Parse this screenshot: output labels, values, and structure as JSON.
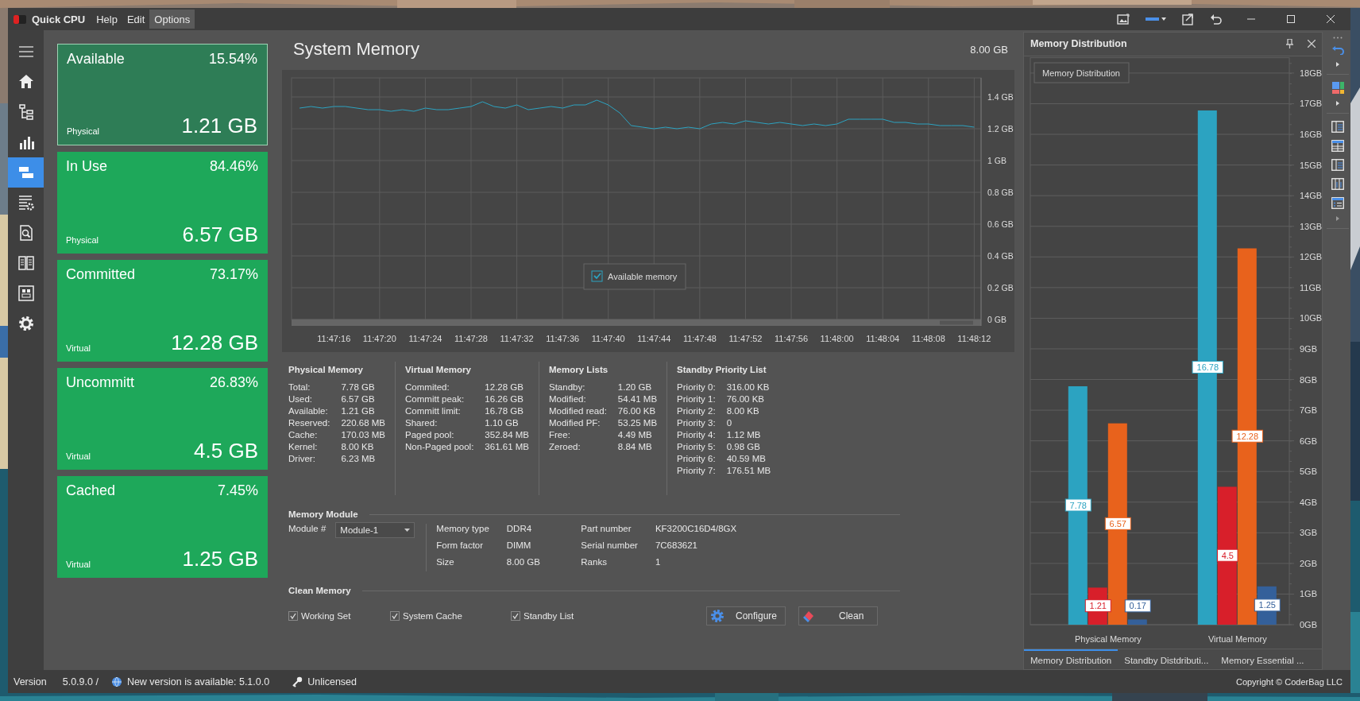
{
  "window": {
    "app_name": "Quick CPU",
    "menu": [
      {
        "label": "Help",
        "selected": false
      },
      {
        "label": "Edit",
        "selected": false
      },
      {
        "label": "Options",
        "selected": true
      }
    ]
  },
  "nav": [
    {
      "kind": "menu",
      "selected": false
    },
    {
      "kind": "home",
      "selected": false
    },
    {
      "kind": "tree",
      "selected": false
    },
    {
      "kind": "bar-chart",
      "selected": false
    },
    {
      "kind": "memory",
      "selected": true
    },
    {
      "kind": "table-settings",
      "selected": false
    },
    {
      "kind": "doc-search",
      "selected": false
    },
    {
      "kind": "book",
      "selected": false
    },
    {
      "kind": "board",
      "selected": false
    },
    {
      "kind": "settings",
      "selected": false
    }
  ],
  "cards": [
    {
      "label": "Available",
      "percent": "15.54%",
      "type": "Physical",
      "value": "1.21 GB",
      "selected": true
    },
    {
      "label": "In Use",
      "percent": "84.46%",
      "type": "Physical",
      "value": "6.57 GB",
      "selected": false
    },
    {
      "label": "Committed",
      "percent": "73.17%",
      "type": "Virtual",
      "value": "12.28 GB",
      "selected": false
    },
    {
      "label": "Uncommitt",
      "percent": "26.83%",
      "type": "Virtual",
      "value": "4.5 GB",
      "selected": false
    },
    {
      "label": "Cached",
      "percent": "7.45%",
      "type": "Virtual",
      "value": "1.25 GB",
      "selected": false
    }
  ],
  "main": {
    "title": "System Memory",
    "total": "8.00 GB",
    "legend_checked": true,
    "chart_data": {
      "type": "line",
      "grid": true,
      "categories": [
        null,
        null,
        null,
        "11:47:16",
        null,
        null,
        null,
        "11:47:20",
        null,
        null,
        null,
        "11:47:24",
        null,
        null,
        null,
        "11:47:28",
        null,
        null,
        null,
        "11:47:32",
        null,
        null,
        null,
        "11:47:36",
        null,
        null,
        null,
        "11:47:40",
        null,
        null,
        null,
        "11:47:44",
        null,
        null,
        null,
        "11:47:48",
        null,
        null,
        null,
        "11:47:52",
        null,
        null,
        null,
        "11:47:56",
        null,
        null,
        null,
        "11:48:00",
        null,
        null,
        null,
        "11:48:04",
        null,
        null,
        null,
        "11:48:08",
        null,
        null,
        null,
        "11:48:12"
      ],
      "series": [
        {
          "name": "Available memory",
          "color": "#2ca3c1",
          "values": [
            1.33,
            1.34,
            1.33,
            1.34,
            1.34,
            1.33,
            1.32,
            1.32,
            1.31,
            1.32,
            1.31,
            1.33,
            1.32,
            1.32,
            1.33,
            1.34,
            1.37,
            1.34,
            1.33,
            1.35,
            1.32,
            1.33,
            1.34,
            1.33,
            1.35,
            1.35,
            1.38,
            1.35,
            1.3,
            1.22,
            1.21,
            1.2,
            1.21,
            1.2,
            1.21,
            1.2,
            1.23,
            1.24,
            1.23,
            1.25,
            1.24,
            1.23,
            1.24,
            1.23,
            1.22,
            1.23,
            1.22,
            1.23,
            1.26,
            1.26,
            1.26,
            1.26,
            1.24,
            1.24,
            1.23,
            1.23,
            1.22,
            1.22,
            1.22,
            1.21
          ]
        }
      ],
      "ylim": [
        0,
        1.52
      ],
      "yticks": [
        {
          "value": 0,
          "label": "0 GB"
        },
        {
          "value": 0.2,
          "label": "0.2 GB"
        },
        {
          "value": 0.4,
          "label": "0.4 GB"
        },
        {
          "value": 0.6,
          "label": "0.6 GB"
        },
        {
          "value": 0.8,
          "label": "0.8 GB"
        },
        {
          "value": 1,
          "label": "1 GB"
        },
        {
          "value": 1.2,
          "label": "1.2 GB"
        },
        {
          "value": 1.4,
          "label": "1.4 GB"
        }
      ]
    }
  },
  "stats": [
    {
      "title": "Physical Memory",
      "rows": [
        {
          "label": "Total:",
          "value": "7.78 GB"
        },
        {
          "label": "Used:",
          "value": "6.57 GB"
        },
        {
          "label": "Available:",
          "value": "1.21 GB"
        },
        {
          "label": "Reserved:",
          "value": "220.68 MB"
        },
        {
          "label": "Cache:",
          "value": "170.03 MB"
        },
        {
          "label": "Kernel:",
          "value": "8.00 KB"
        },
        {
          "label": "Driver:",
          "value": "6.23 MB"
        }
      ]
    },
    {
      "title": "Virtual Memory",
      "rows": [
        {
          "label": "Commited:",
          "value": "12.28 GB"
        },
        {
          "label": "Committ peak:",
          "value": "16.26 GB"
        },
        {
          "label": "Committ limit:",
          "value": "16.78 GB"
        },
        {
          "label": "Shared:",
          "value": "1.10 GB"
        },
        {
          "label": "Paged pool:",
          "value": "352.84 MB"
        },
        {
          "label": "Non-Paged pool:",
          "value": "361.61 MB"
        }
      ]
    },
    {
      "title": "Memory Lists",
      "rows": [
        {
          "label": "Standby:",
          "value": "1.20 GB"
        },
        {
          "label": "Modified:",
          "value": "54.41 MB"
        },
        {
          "label": "Modified read:",
          "value": "76.00 KB"
        },
        {
          "label": "Modified PF:",
          "value": "53.25 MB"
        },
        {
          "label": "Free:",
          "value": "4.49 MB"
        },
        {
          "label": "Zeroed:",
          "value": "8.84 MB"
        }
      ]
    },
    {
      "title": "Standby Priority List",
      "rows": [
        {
          "label": "Priority 0:",
          "value": "316.00 KB"
        },
        {
          "label": "Priority 1:",
          "value": "76.00 KB"
        },
        {
          "label": "Priority 2:",
          "value": "8.00 KB"
        },
        {
          "label": "Priority 3:",
          "value": "0"
        },
        {
          "label": "Priority 4:",
          "value": "1.12 MB"
        },
        {
          "label": "Priority 5:",
          "value": "0.98 GB"
        },
        {
          "label": "Priority 6:",
          "value": "40.59 MB"
        },
        {
          "label": "Priority 7:",
          "value": "176.51 MB"
        }
      ]
    }
  ],
  "memory_module": {
    "title": "Memory Module",
    "module_label": "Module #",
    "module_value": "Module-1",
    "columns": [
      [
        {
          "label": "Memory type",
          "value": "DDR4"
        },
        {
          "label": "Form factor",
          "value": "DIMM"
        },
        {
          "label": "Size",
          "value": "8.00 GB"
        }
      ],
      [
        {
          "label": "Part number",
          "value": "KF3200C16D4/8GX"
        },
        {
          "label": "Serial number",
          "value": "7C683621"
        },
        {
          "label": "Ranks",
          "value": "1"
        }
      ]
    ]
  },
  "clean_memory": {
    "title": "Clean Memory",
    "options": [
      {
        "label": "Working Set",
        "checked": true
      },
      {
        "label": "System Cache",
        "checked": true
      },
      {
        "label": "Standby List",
        "checked": true
      }
    ],
    "buttons": [
      {
        "label": "Configure",
        "kind": "configure"
      },
      {
        "label": "Clean",
        "kind": "clean"
      }
    ]
  },
  "distribution": {
    "title": "Memory Distribution",
    "chart_data": {
      "type": "bar",
      "grid": true,
      "title": "Memory Distribution",
      "categories": [
        "Physical Memory",
        "Virtual Memory"
      ],
      "series": [
        {
          "color": "#2ca3c1",
          "values": [
            7.78,
            16.78
          ]
        },
        {
          "color": "#d81f2a",
          "values": [
            1.21,
            4.5
          ]
        },
        {
          "color": "#e8621c",
          "values": [
            6.57,
            12.28
          ]
        },
        {
          "color": "#34609a",
          "values": [
            0.17,
            1.25
          ]
        }
      ],
      "ylim": [
        0,
        18.5
      ],
      "data_labels": true,
      "yticks": [
        {
          "value": 0,
          "label": "0GB"
        },
        {
          "value": 1,
          "label": "1GB"
        },
        {
          "value": 2,
          "label": "2GB"
        },
        {
          "value": 3,
          "label": "3GB"
        },
        {
          "value": 4,
          "label": "4GB"
        },
        {
          "value": 5,
          "label": "5GB"
        },
        {
          "value": 6,
          "label": "6GB"
        },
        {
          "value": 7,
          "label": "7GB"
        },
        {
          "value": 8,
          "label": "8GB"
        },
        {
          "value": 9,
          "label": "9GB"
        },
        {
          "value": 10,
          "label": "10GB"
        },
        {
          "value": 11,
          "label": "11GB"
        },
        {
          "value": 12,
          "label": "12GB"
        },
        {
          "value": 13,
          "label": "13GB"
        },
        {
          "value": 14,
          "label": "14GB"
        },
        {
          "value": 15,
          "label": "15GB"
        },
        {
          "value": 16,
          "label": "16GB"
        },
        {
          "value": 17,
          "label": "17GB"
        },
        {
          "value": 18,
          "label": "18GB"
        }
      ]
    },
    "tabs": [
      {
        "label": "Memory Distribution",
        "selected": true
      },
      {
        "label": "Standby Distdributi...",
        "selected": false
      },
      {
        "label": "Memory Essential ...",
        "selected": false
      }
    ]
  },
  "status_bar": {
    "version_label": "Version",
    "version": "5.0.9.0 /",
    "update": "New version is available: 5.1.0.0",
    "license": "Unlicensed",
    "copyright": "Copyright © CoderBag LLC"
  }
}
